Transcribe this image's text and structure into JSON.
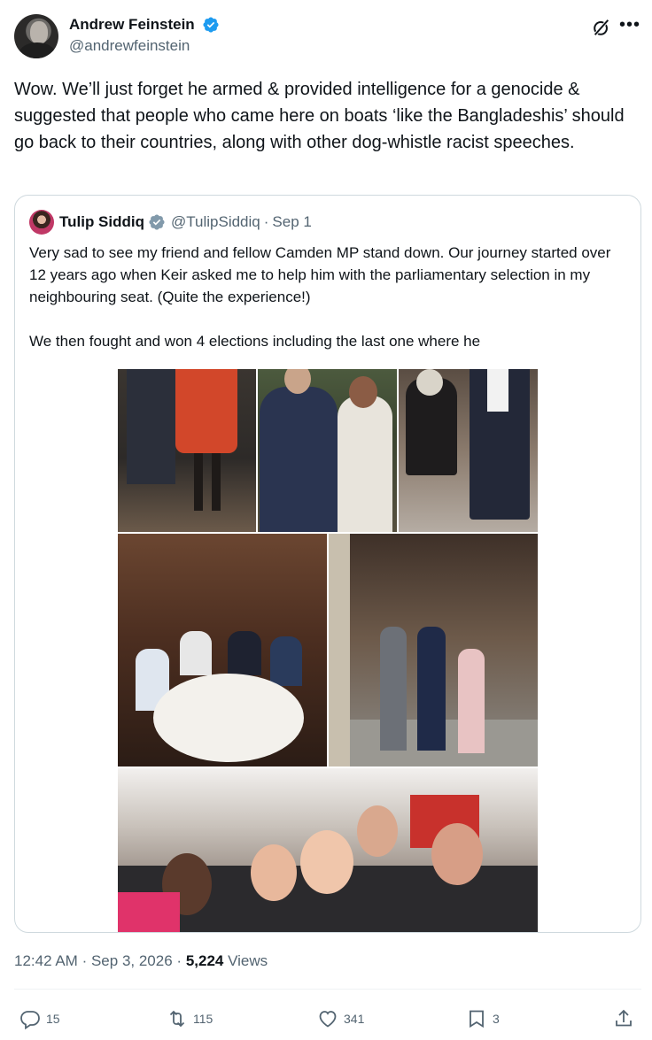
{
  "author": {
    "display_name": "Andrew Feinstein",
    "handle": "@andrewfeinstein",
    "verified_icon": "verified-badge-icon"
  },
  "tweet": {
    "text": "Wow. We’ll just forget he  armed & provided intelligence for a genocide & suggested that people who came here on boats ‘like the Bangladeshis’ should go back to their countries, along with other dog-whistle racist speeches."
  },
  "quoted": {
    "display_name": "Tulip Siddiq",
    "handle": "@TulipSiddiq",
    "separator": "·",
    "date": "Sep 1",
    "text": "Very sad to see my friend and fellow Camden MP stand down. Our journey started over 12 years ago when Keir asked me to help him with the parliamentary selection in my neighbouring seat. (Quite the experience!)\n\nWe then fought and won 4 elections including the last one where he"
  },
  "meta": {
    "time": "12:42 AM",
    "sep1": "·",
    "date": "Sep 3, 2026",
    "sep2": "·",
    "views_count": "5,224",
    "views_label": "Views"
  },
  "actions": {
    "replies": "15",
    "reposts": "115",
    "likes": "341",
    "bookmarks": "3"
  },
  "colors": {
    "text": "#0f1419",
    "secondary": "#536471",
    "verified_blue": "#1d9bf0",
    "verified_gray": "#829aab",
    "border": "#cfd9de"
  }
}
